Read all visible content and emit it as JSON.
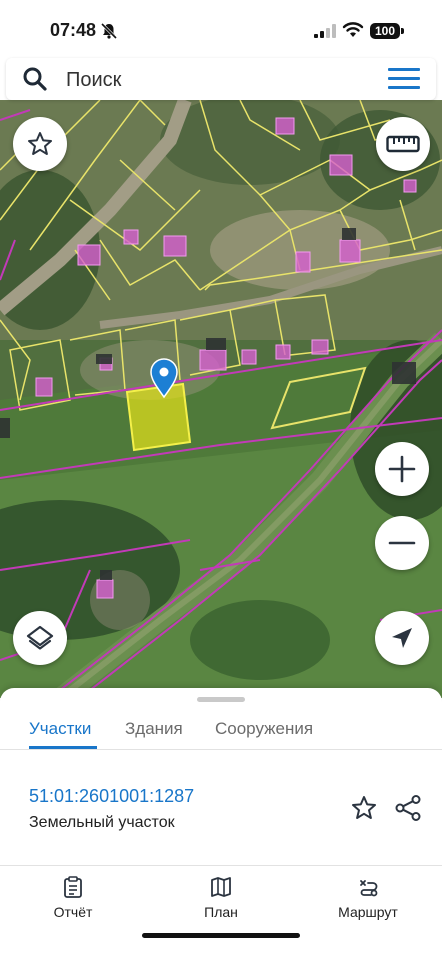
{
  "status_bar": {
    "time": "07:48",
    "battery": "100"
  },
  "search": {
    "placeholder": "Поиск"
  },
  "map": {
    "icons": [
      "star-icon",
      "ruler-icon",
      "plus-icon",
      "minus-icon",
      "layers-icon",
      "navigation-arrow-icon",
      "location-pin-icon"
    ],
    "colors": {
      "parcel_border": "#e8e36a",
      "building": "#d65fd0",
      "selected_parcel": "#e6e21a",
      "boundary": "#c23ab8"
    }
  },
  "sheet": {
    "tabs": [
      {
        "label": "Участки",
        "active": true
      },
      {
        "label": "Здания",
        "active": false
      },
      {
        "label": "Сооружения",
        "active": false
      }
    ],
    "parcel": {
      "number": "51:01:2601001:1287",
      "type": "Земельный участок"
    }
  },
  "bottom_nav": {
    "items": [
      {
        "label": "Отчёт",
        "icon": "report-icon"
      },
      {
        "label": "План",
        "icon": "map-icon"
      },
      {
        "label": "Маршрут",
        "icon": "route-icon"
      }
    ]
  },
  "accent_color": "#1976c9"
}
